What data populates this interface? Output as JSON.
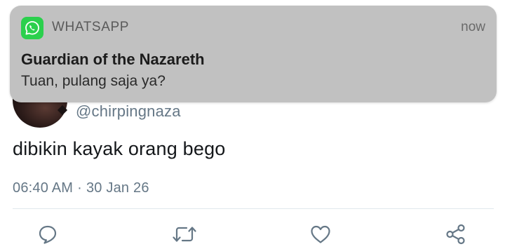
{
  "tweet": {
    "handle": "@chirpingnaza",
    "text": "dibikin kayak orang bego",
    "time": "06:40 AM",
    "separator": "·",
    "date": "30 Jan 26"
  },
  "actions": [
    {
      "icon": "reply-icon"
    },
    {
      "icon": "retweet-icon"
    },
    {
      "icon": "like-icon"
    },
    {
      "icon": "share-icon"
    }
  ],
  "notification": {
    "app_name": "WHATSAPP",
    "time": "now",
    "title": "Guardian of the Nazareth",
    "body": "Tuan, pulang saja ya?",
    "icon": "whatsapp-icon",
    "accent_color": "#2bd04d"
  },
  "colors": {
    "text_primary": "#14171a",
    "text_secondary": "#657786",
    "notification_bg": "#c1c1c1"
  }
}
